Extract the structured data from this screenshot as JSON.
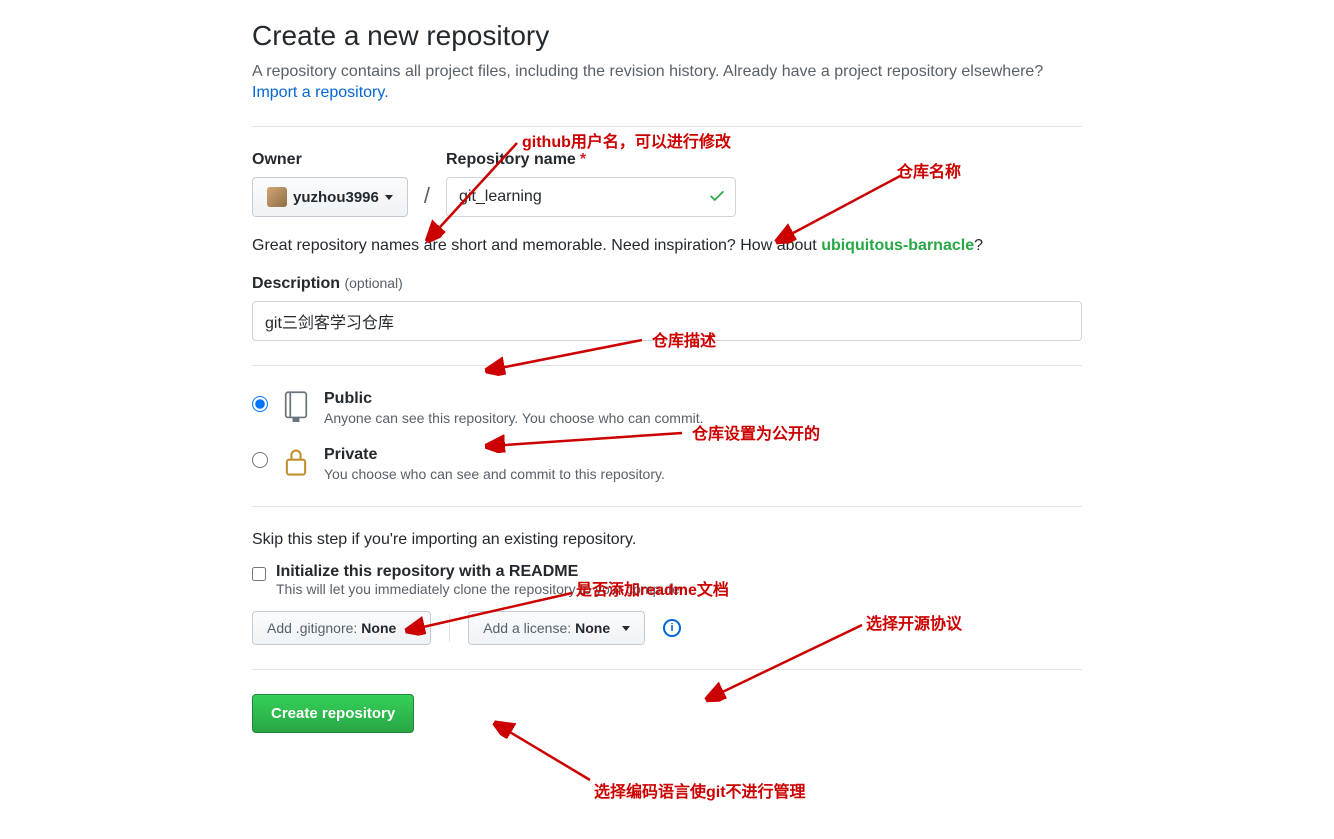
{
  "header": {
    "title": "Create a new repository",
    "subhead": "A repository contains all project files, including the revision history. Already have a project repository elsewhere?",
    "import_link": "Import a repository."
  },
  "form": {
    "owner_label": "Owner",
    "owner_name": "yuzhou3996",
    "slash": "/",
    "repo_label": "Repository name",
    "repo_value": "git_learning",
    "hint_text_prefix": "Great repository names are short and memorable. Need inspiration? How about ",
    "suggestion": "ubiquitous-barnacle",
    "hint_text_suffix": "?",
    "desc_label": "Description",
    "desc_optional": "(optional)",
    "desc_value": "git三剑客学习仓库",
    "visibility": {
      "public": {
        "title": "Public",
        "desc": "Anyone can see this repository. You choose who can commit."
      },
      "private": {
        "title": "Private",
        "desc": "You choose who can see and commit to this repository."
      }
    },
    "skip_note": "Skip this step if you're importing an existing repository.",
    "readme": {
      "title": "Initialize this repository with a README",
      "desc": "This will let you immediately clone the repository to your computer."
    },
    "gitignore_prefix": "Add .gitignore: ",
    "gitignore_value": "None",
    "license_prefix": "Add a license: ",
    "license_value": "None",
    "submit_label": "Create repository"
  },
  "annotations": {
    "owner": "github用户名，可以进行修改",
    "repo": "仓库名称",
    "desc": "仓库描述",
    "public": "仓库设置为公开的",
    "readme": "是否添加readme文档",
    "license": "选择开源协议",
    "gitignore": "选择编码语言使git不进行管理"
  }
}
